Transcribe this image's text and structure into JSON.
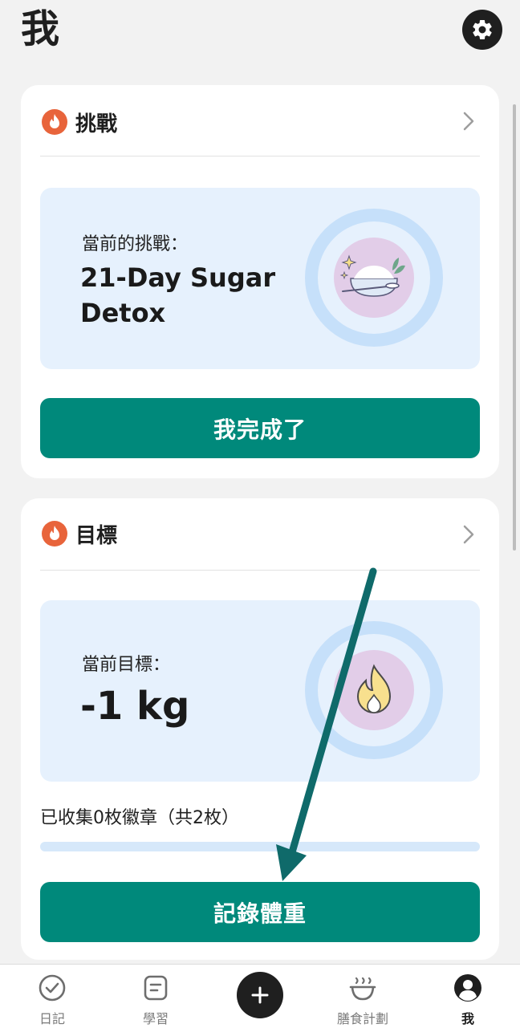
{
  "header": {
    "title": "我",
    "settings_icon": "gear-icon"
  },
  "challenge_card": {
    "title": "挑戰",
    "current_label": "當前的挑戰：",
    "current_value_line1": "21-Day Sugar",
    "current_value_line2": "Detox",
    "illustration": "sugar-bowl-icon",
    "button_label": "我完成了"
  },
  "goal_card": {
    "title": "目標",
    "current_label": "當前目標：",
    "current_value": "-1 kg",
    "illustration": "flame-icon",
    "badges_text": "已收集0枚徽章（共2枚）",
    "badges_progress": 0,
    "button_label": "記錄體重"
  },
  "tabbar": {
    "tabs": [
      {
        "label": "日記",
        "icon": "check-circle-icon"
      },
      {
        "label": "學習",
        "icon": "document-icon"
      },
      {
        "label": "膳食計劃",
        "icon": "bowl-icon"
      },
      {
        "label": "我",
        "icon": "profile-icon"
      }
    ],
    "add_icon": "plus-icon"
  },
  "colors": {
    "accent": "#00897b",
    "flame_badge": "#e8643b",
    "panel_bg": "#e6f1fd",
    "annotation_arrow": "#0f6a6a"
  }
}
